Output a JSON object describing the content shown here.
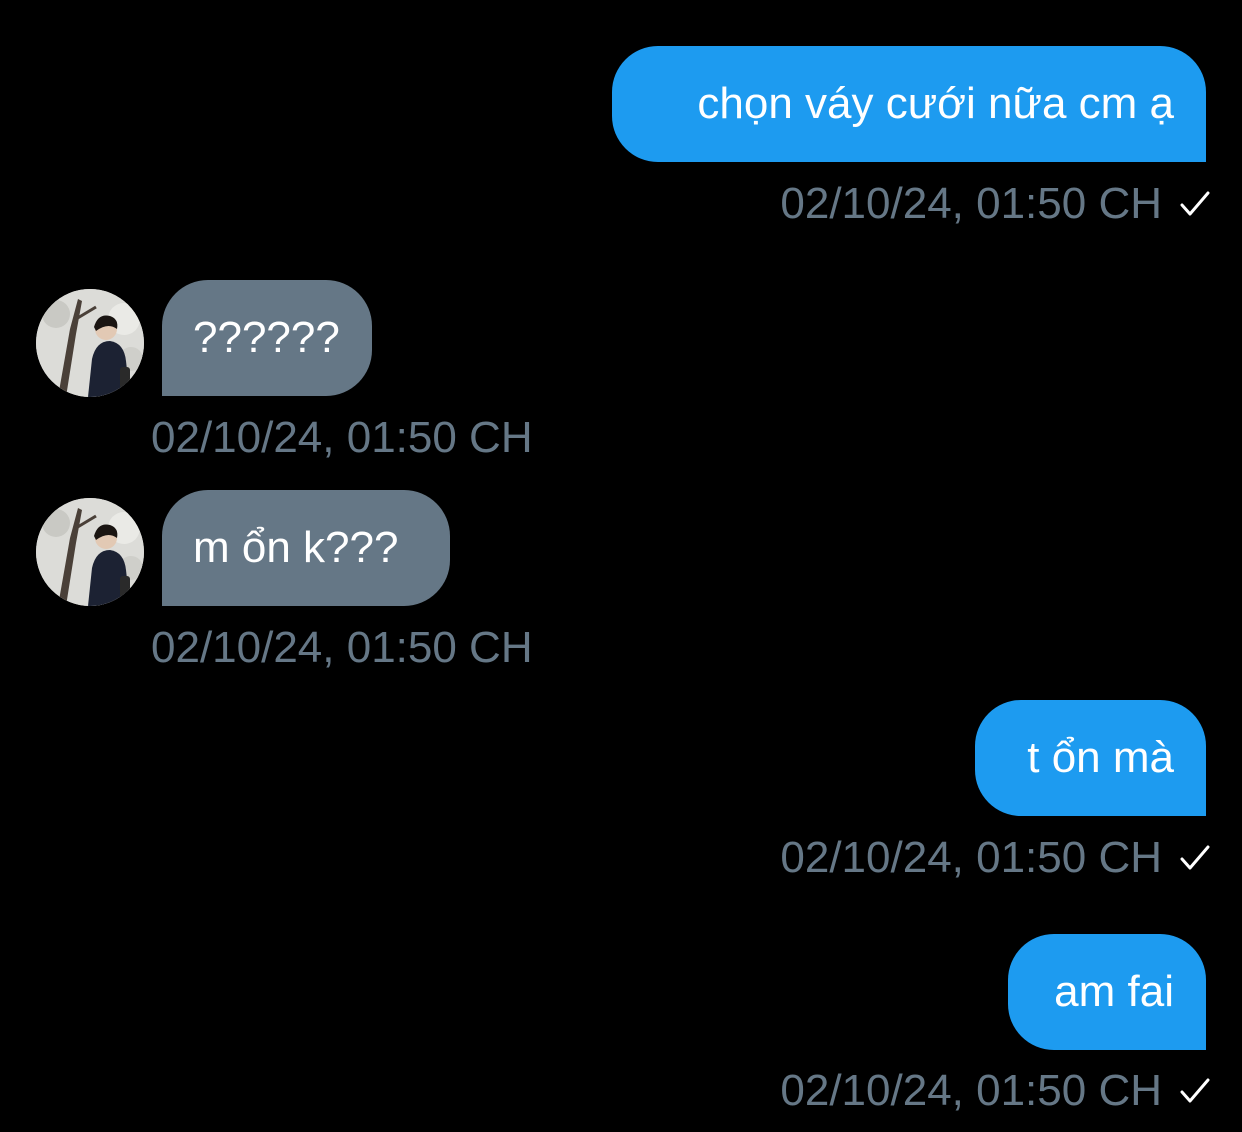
{
  "conversation": {
    "messages": [
      {
        "direction": "outgoing",
        "text": "chọn váy cưới nữa cm ạ",
        "time": "02/10/24, 01:50 CH",
        "status": "check-icon"
      },
      {
        "direction": "incoming",
        "text": "??????",
        "time": "02/10/24, 01:50 CH"
      },
      {
        "direction": "incoming",
        "text": "m ổn k???",
        "time": "02/10/24, 01:50 CH"
      },
      {
        "direction": "outgoing",
        "text": "t ổn mà",
        "time": "02/10/24, 01:50 CH",
        "status": "check-icon"
      },
      {
        "direction": "outgoing",
        "text": "am fai",
        "time": "02/10/24, 01:50 CH",
        "status": "check-icon"
      }
    ]
  },
  "colors": {
    "background": "#000000",
    "outgoing_bubble": "#1d9bf0",
    "incoming_bubble": "#657786",
    "timestamp": "#657786",
    "text": "#ffffff"
  }
}
